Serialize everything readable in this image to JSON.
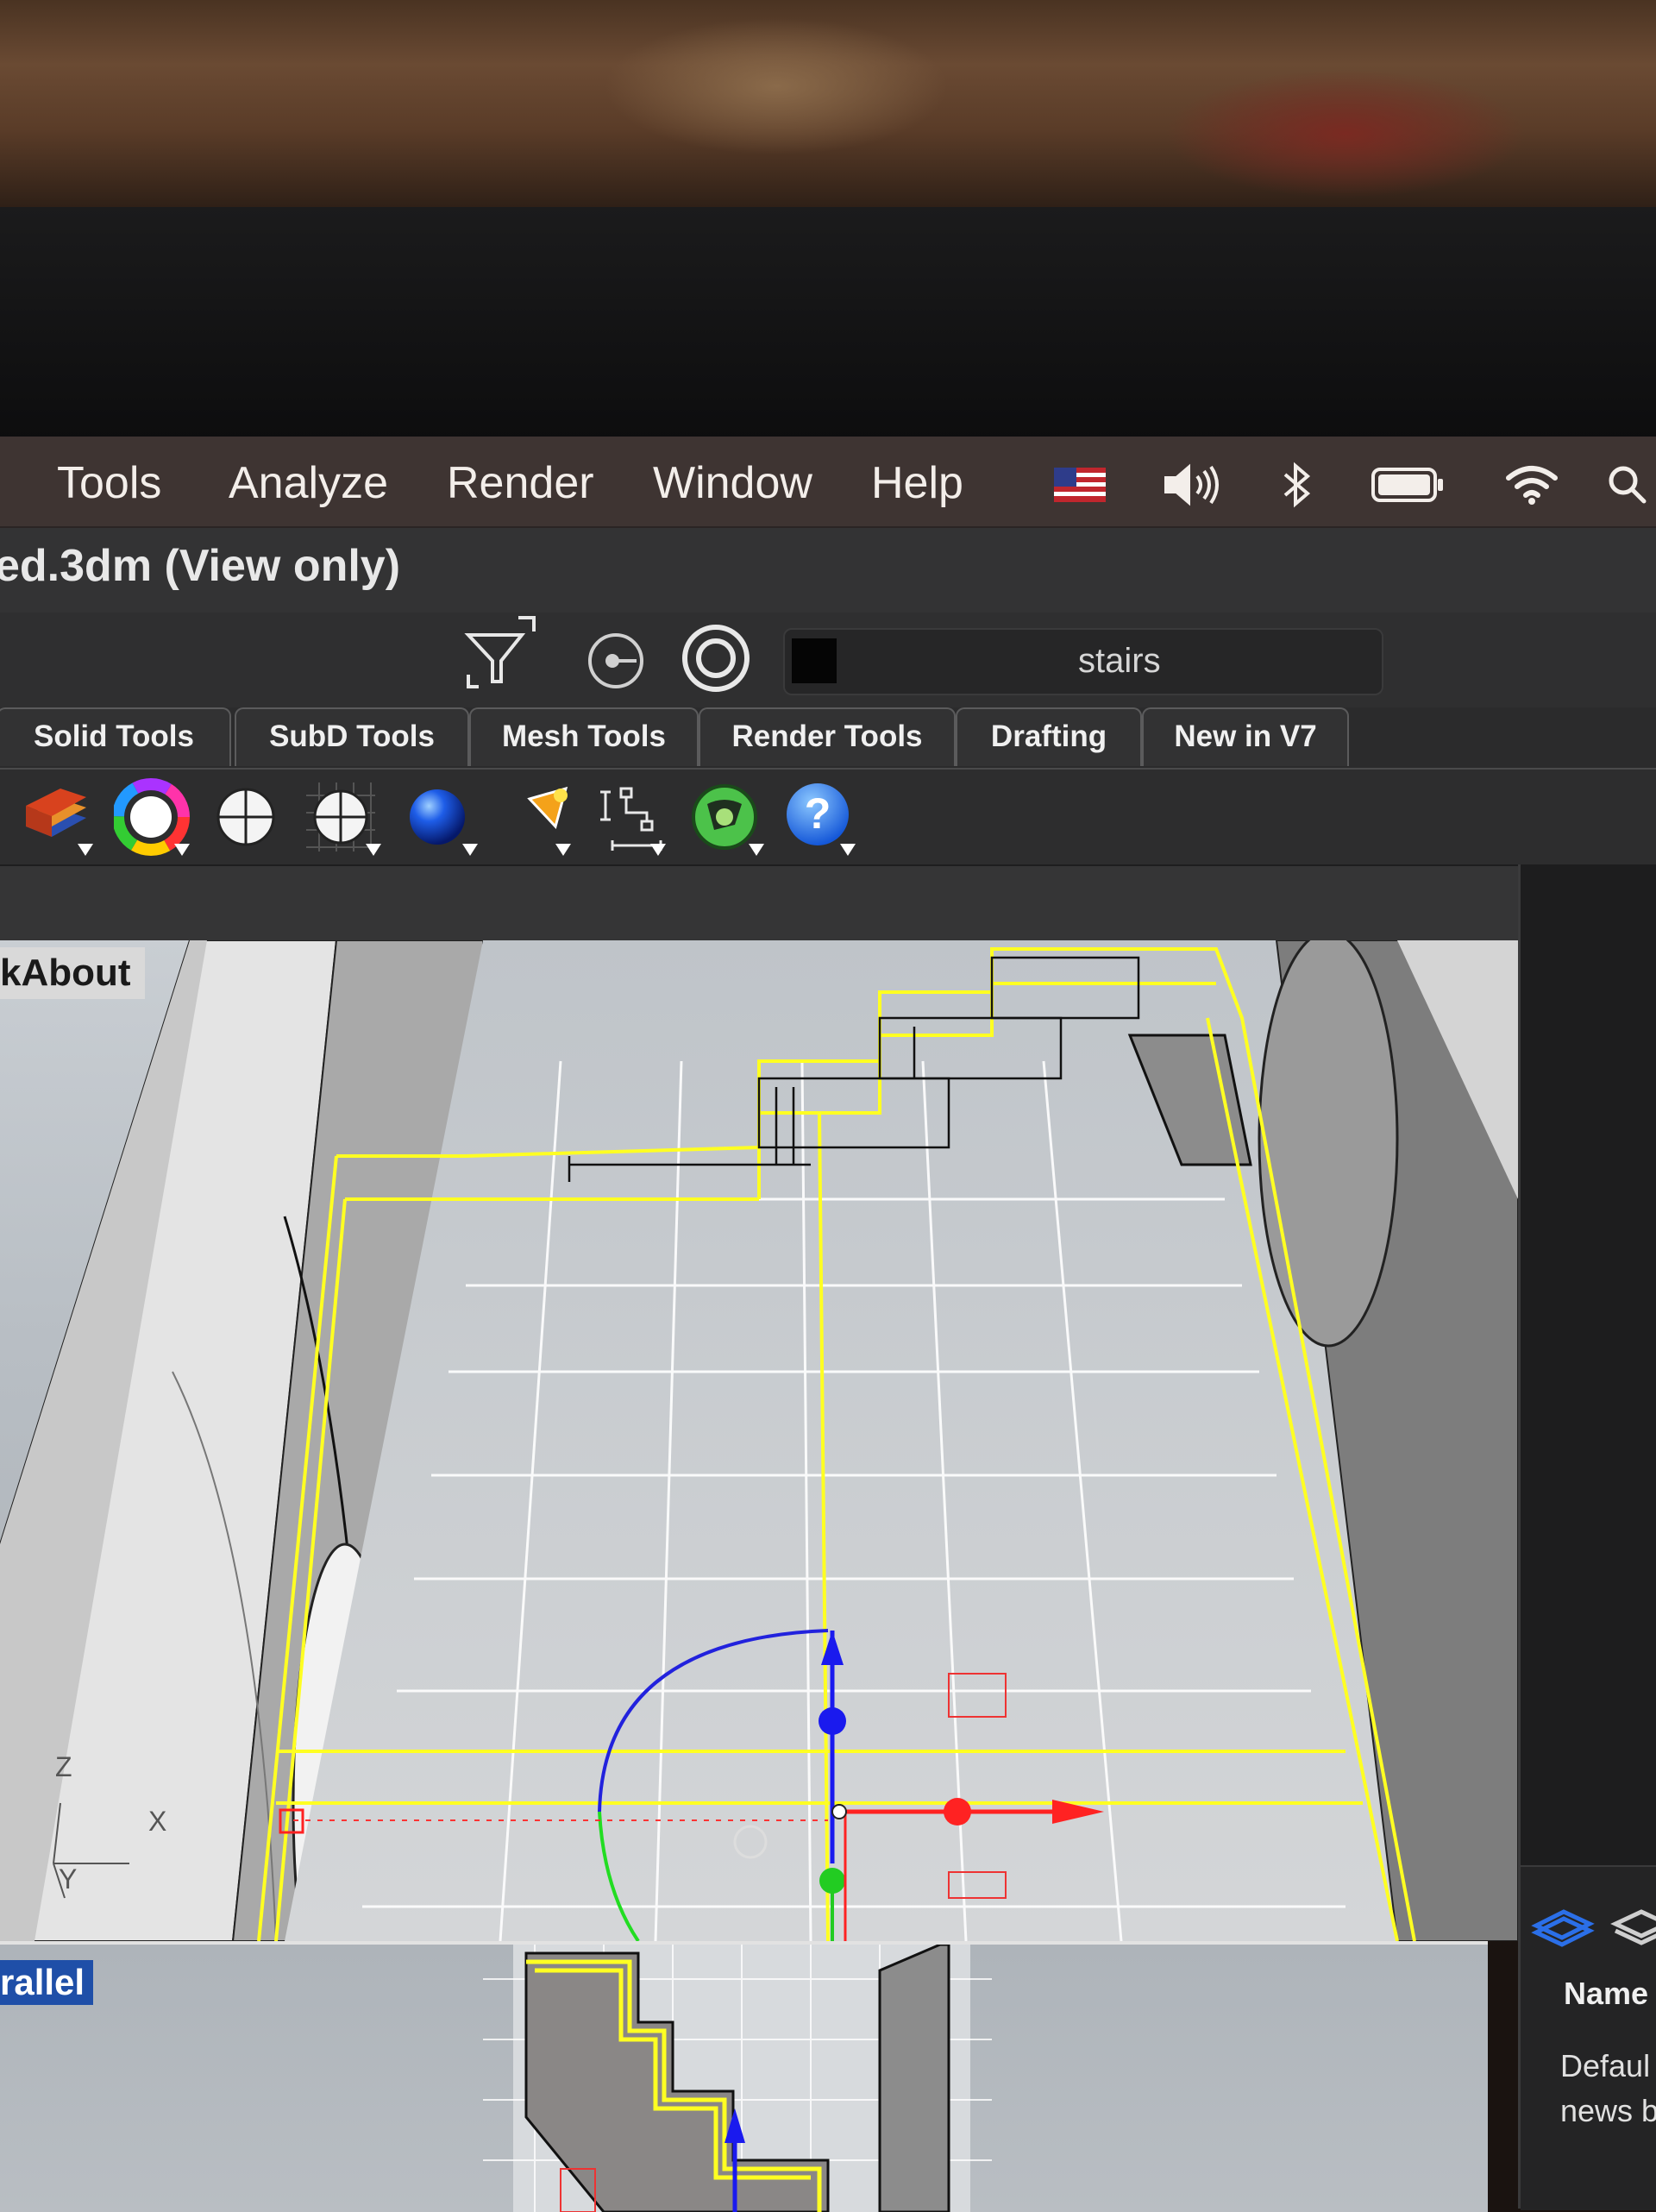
{
  "menubar": {
    "items": [
      "Tools",
      "Analyze",
      "Render",
      "Window",
      "Help"
    ],
    "status_icons": [
      "us-flag-icon",
      "volume-icon",
      "bluetooth-icon",
      "battery-icon",
      "wifi-icon",
      "search-icon"
    ]
  },
  "window": {
    "title": "ed.3dm (View only)"
  },
  "command_toolbar": {
    "icons": [
      "filter-icon",
      "point-snap-icon",
      "target-icon"
    ],
    "current_layer": "stairs"
  },
  "tabs": [
    "Solid Tools",
    "SubD Tools",
    "Mesh Tools",
    "Render Tools",
    "Drafting",
    "New in V7"
  ],
  "toolbar_icons": [
    "layers-icon",
    "color-wheel-icon",
    "shaded-sphere-icon",
    "grid-sphere-icon",
    "rendered-sphere-icon",
    "light-cone-icon",
    "dimension-icon",
    "globe-icon",
    "help-icon"
  ],
  "viewports": {
    "main_title": "kAbout",
    "axis_labels": {
      "z": "Z",
      "x": "X",
      "y": "Y"
    },
    "secondary_title": "rallel"
  },
  "right_panel": {
    "column_header": "Name",
    "row1": "Defaul",
    "row2": "news b"
  },
  "colors": {
    "selection": "#ffff22",
    "gumball_x": "#ff2222",
    "gumball_y": "#22cc22",
    "gumball_z": "#1a1aee",
    "accent_blue": "#1f4fa8"
  }
}
